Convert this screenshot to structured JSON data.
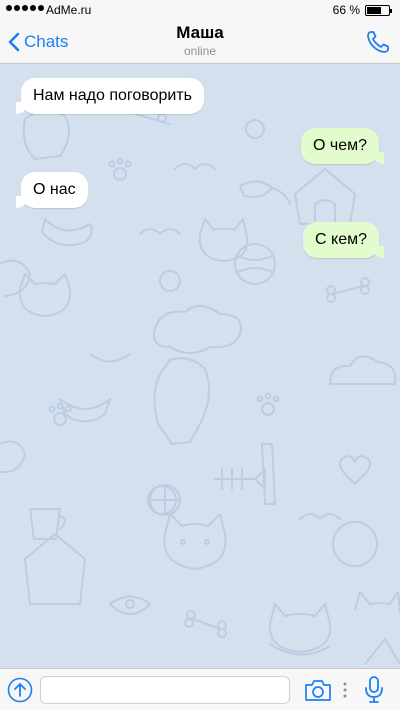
{
  "status_bar": {
    "carrier": "AdMe.ru",
    "battery_percent": "66 %",
    "battery_level": 0.66,
    "signal_bars": 5
  },
  "nav": {
    "back_label": "Chats",
    "contact_name": "Маша",
    "contact_status": "online"
  },
  "messages": [
    {
      "direction": "in",
      "text": "Нам надо поговорить"
    },
    {
      "direction": "out",
      "text": "О чем?"
    },
    {
      "direction": "in",
      "text": "О нас"
    },
    {
      "direction": "out",
      "text": "С кем?"
    }
  ],
  "input": {
    "placeholder": "",
    "value": ""
  },
  "colors": {
    "accent": "#1d7ff1",
    "chat_background": "#d4e0ee",
    "incoming_bubble": "#ffffff",
    "outgoing_bubble": "#e3fccd"
  },
  "icons": {
    "back": "chevron-left-icon",
    "call": "phone-icon",
    "attach": "attach-arrow-up-icon",
    "camera": "camera-icon",
    "more": "vertical-dots-icon",
    "mic": "microphone-icon"
  }
}
